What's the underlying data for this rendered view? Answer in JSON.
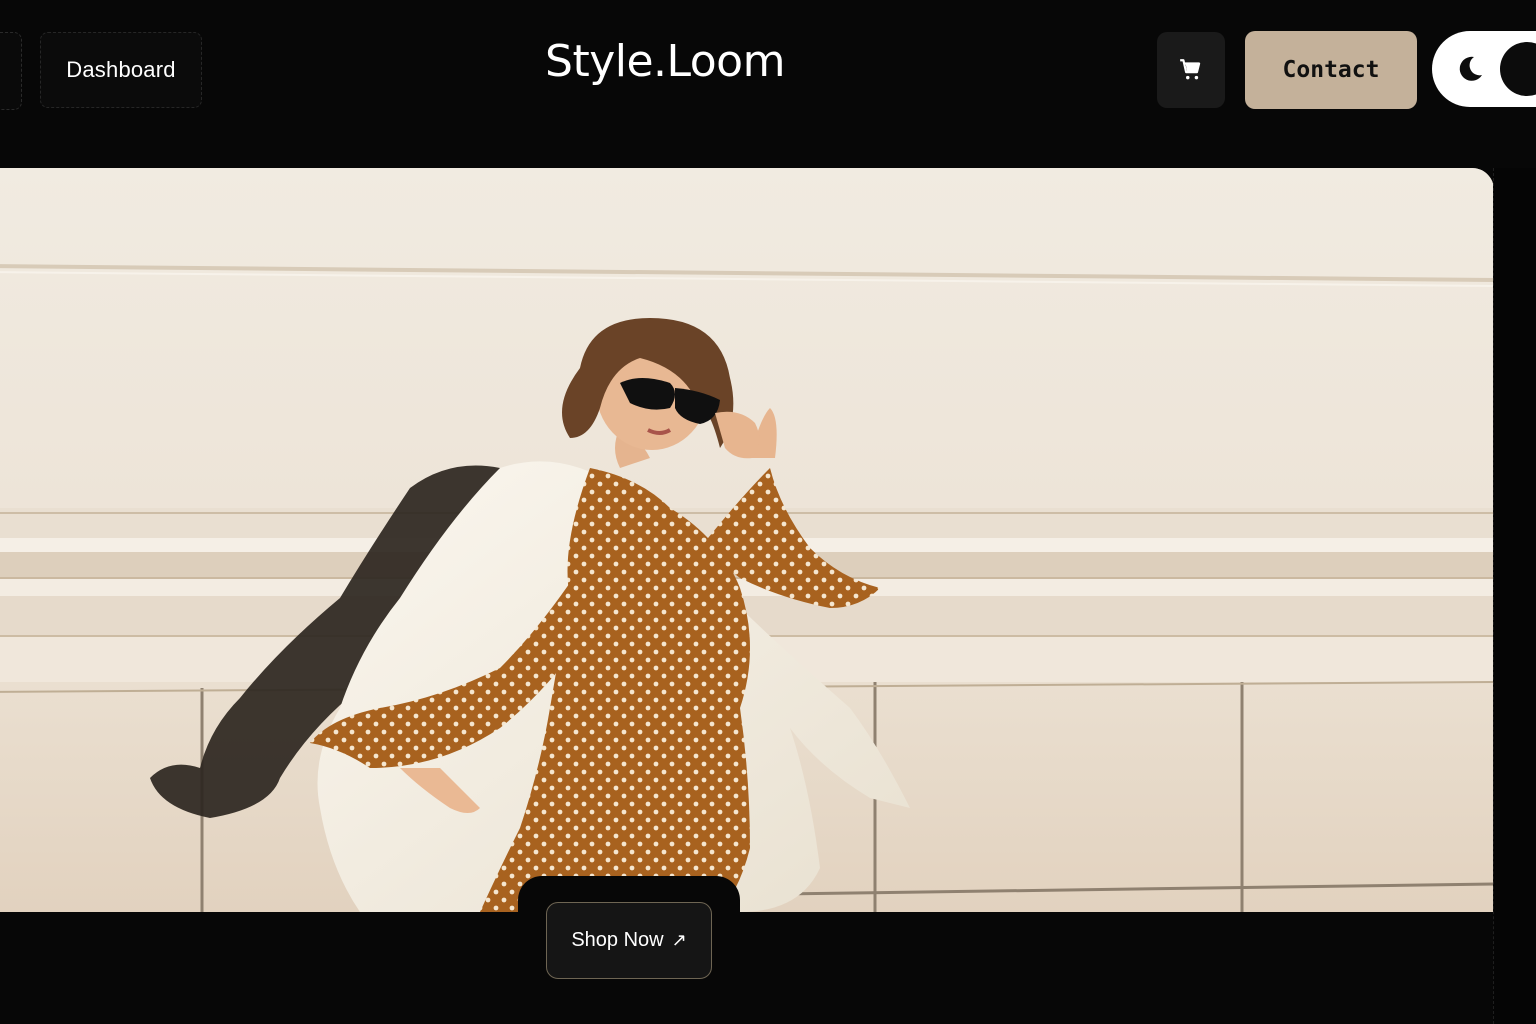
{
  "header": {
    "dashboard_label": "Dashboard",
    "brand": "Style.Loom",
    "cart_icon": "cart-icon",
    "contact_label": "Contact",
    "theme_toggle_icon": "moon-icon"
  },
  "hero": {
    "image_alt": "hero-fashion-photo",
    "cta_label": "Shop Now",
    "cta_icon": "arrow-up-right-icon",
    "cta_arrow": "↗"
  },
  "colors": {
    "background": "#070707",
    "accent": "#c4b19a",
    "text": "#ffffff",
    "dress": "#a8621f"
  }
}
